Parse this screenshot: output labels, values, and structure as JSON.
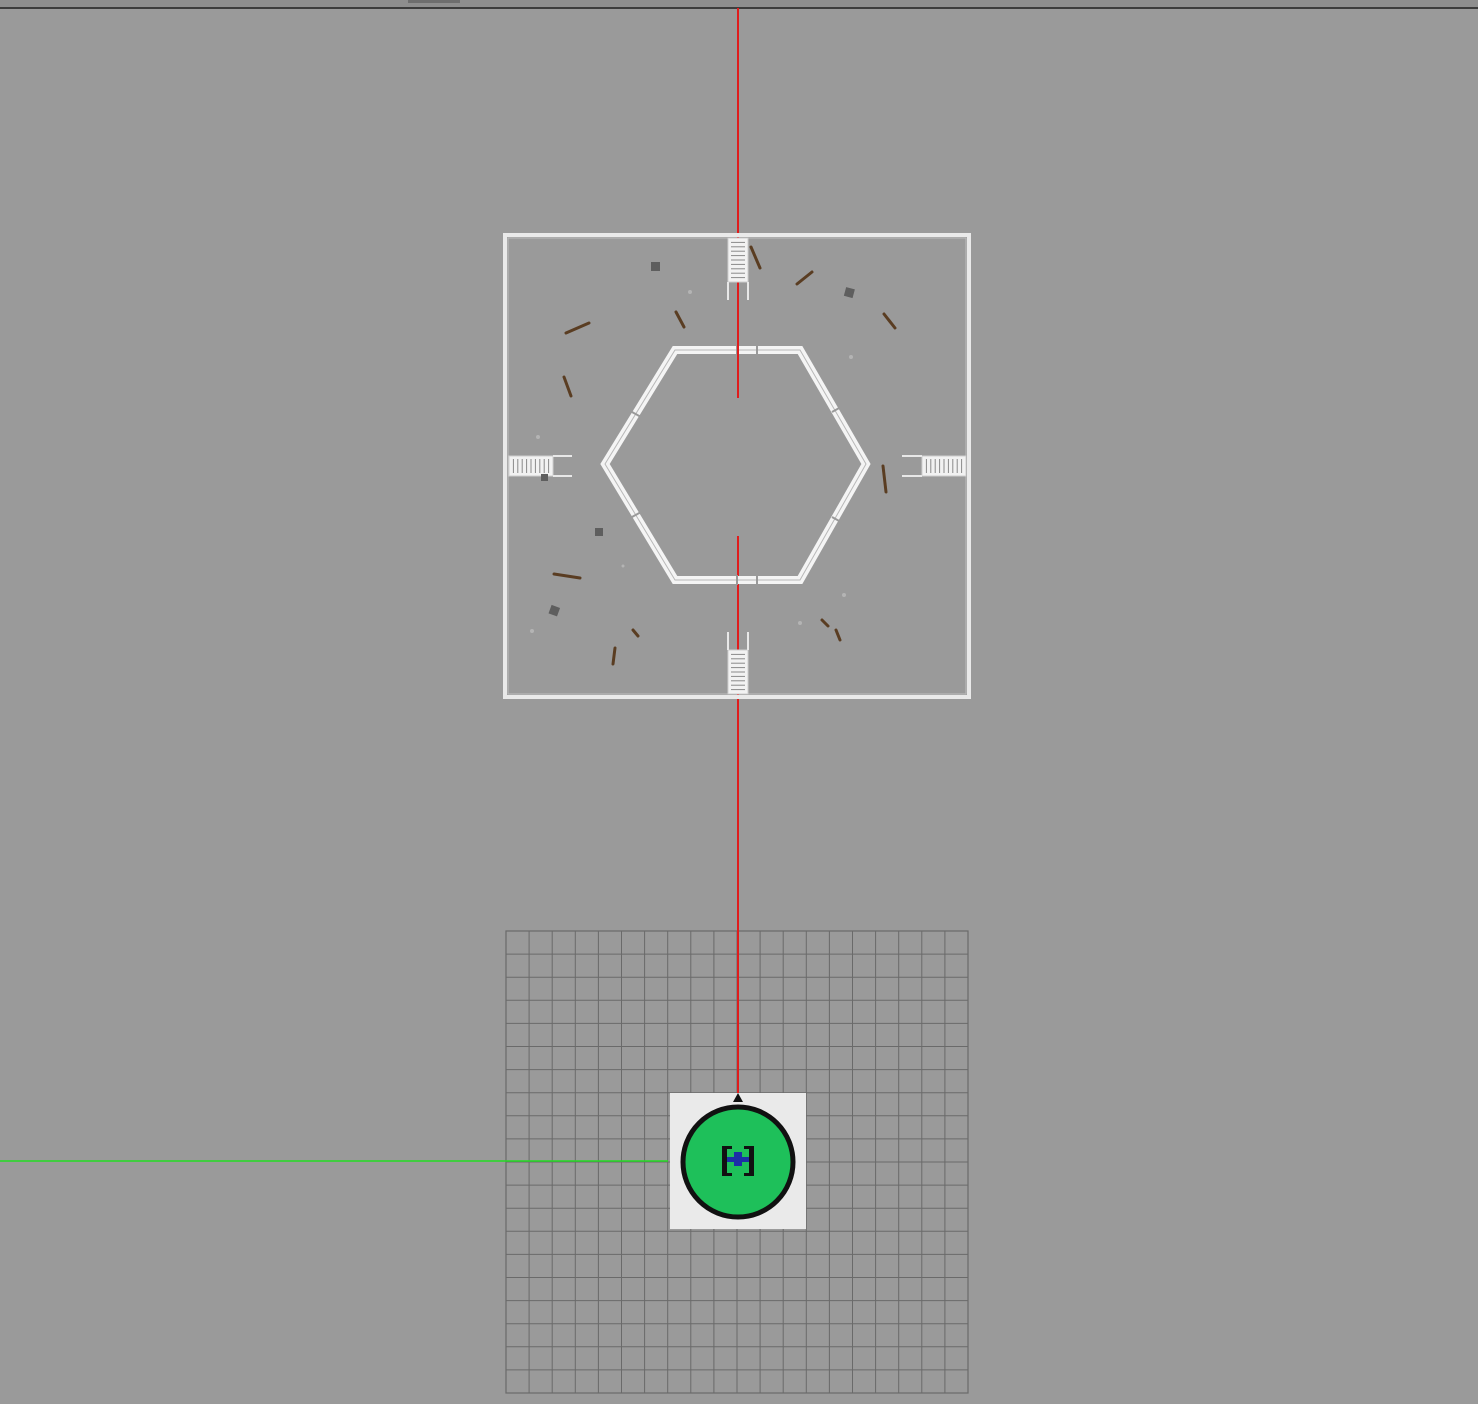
{
  "viewport": {
    "background": "#9a9a9a",
    "axis_colors": {
      "y_axis": "#e01c1c",
      "x_axis": "#22dd22"
    }
  },
  "scene_objects": [
    {
      "name": "arena-floor",
      "type": "walled-square-arena",
      "wall_color": "#eeeeee"
    },
    {
      "name": "hexagon-ring",
      "type": "hexagon-railing",
      "color": "#f2f2f2"
    },
    {
      "name": "entry-stairs",
      "count": 4,
      "sides": [
        "north",
        "south",
        "east",
        "west"
      ]
    },
    {
      "name": "debris",
      "type": "scattered-planks-and-blocks"
    },
    {
      "name": "ground-grid",
      "type": "grid-plane",
      "line_color": "#6a6a6a"
    }
  ],
  "player_marker": {
    "icon": "robot-avatar-icon",
    "fill_color": "#1ec05a",
    "ring_color": "#111111",
    "backdrop_color": "#eaeaea",
    "heading": "north"
  }
}
